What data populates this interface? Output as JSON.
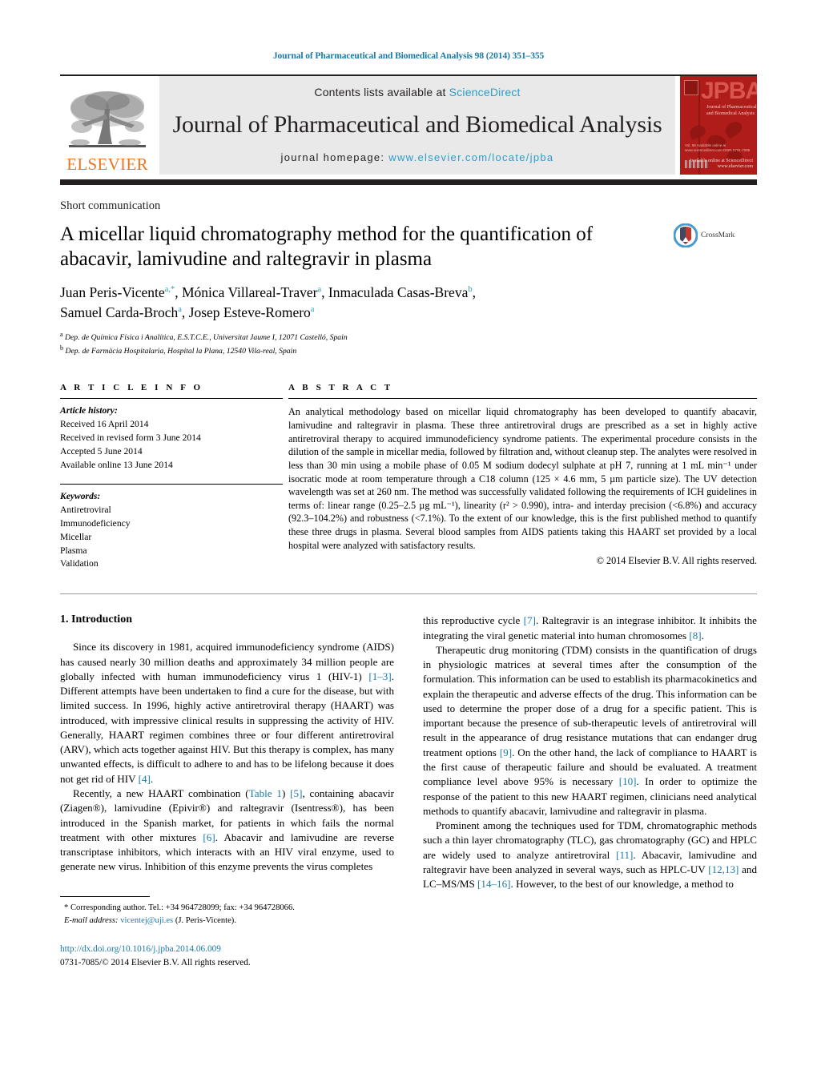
{
  "running_head": "Journal of Pharmaceutical and Biomedical Analysis 98 (2014) 351–355",
  "masthead": {
    "contents_prefix": "Contents lists available at ",
    "sciencedirect": "ScienceDirect",
    "journal_name": "Journal of Pharmaceutical and Biomedical Analysis",
    "homepage_prefix": "journal homepage: ",
    "homepage_url": "www.elsevier.com/locate/jpba",
    "publisher_wordmark": "ELSEVIER",
    "cover_acronym": "JPBA",
    "cover_subtitle": "Journal of Pharmaceutical and Biomedical Analysis",
    "cover_lowtext": "Vol. 98\nAvailable online at\nwww.sciencedirect.com\nISSN 0731-7085",
    "cover_footlogo": "Available online at\nScienceDirect\nwww.elsevier.com",
    "accent_blue": "#1a7aa8",
    "link_blue": "#2a9ecb",
    "elsevier_orange": "#e87722",
    "cover_red": "#b01c19",
    "bar_dark": "#231f20"
  },
  "article": {
    "type": "Short communication",
    "title": "A micellar liquid chromatography method for the quantification of abacavir, lamivudine and raltegravir in plasma",
    "crossmark_label": "CrossMark",
    "authors_line1_a": "Juan Peris-Vicente",
    "authors_line1_a_sup": "a,*",
    "authors_line1_b": ", Mónica Villareal-Traver",
    "authors_line1_b_sup": "a",
    "authors_line1_c": ", Inmaculada Casas-Breva",
    "authors_line1_c_sup": "b",
    "authors_line1_tail": ",",
    "authors_line2_a": "Samuel Carda-Broch",
    "authors_line2_a_sup": "a",
    "authors_line2_b": ", Josep Esteve-Romero",
    "authors_line2_b_sup": "a",
    "affiliation_a_sup": "a",
    "affiliation_a": "Dep. de Química Física i Analítica, E.S.T.C.E., Universitat Jaume I, 12071 Castelló, Spain",
    "affiliation_b_sup": "b",
    "affiliation_b": "Dep. de Farmàcia Hospitalaria, Hospital la Plana, 12540 Vila-real, Spain"
  },
  "article_info": {
    "heading": "A R T I C L E    I N F O",
    "history_title": "Article history:",
    "history": [
      "Received 16 April 2014",
      "Received in revised form 3 June 2014",
      "Accepted 5 June 2014",
      "Available online 13 June 2014"
    ],
    "keywords_title": "Keywords:",
    "keywords": [
      "Antiretroviral",
      "Immunodeficiency",
      "Micellar",
      "Plasma",
      "Validation"
    ]
  },
  "abstract": {
    "heading": "A B S T R A C T",
    "text": "An analytical methodology based on micellar liquid chromatography has been developed to quantify abacavir, lamivudine and raltegravir in plasma. These three antiretroviral drugs are prescribed as a set in highly active antiretroviral therapy to acquired immunodeficiency syndrome patients. The experimental procedure consists in the dilution of the sample in micellar media, followed by filtration and, without cleanup step. The analytes were resolved in less than 30 min using a mobile phase of 0.05 M sodium dodecyl sulphate at pH 7, running at 1 mL min⁻¹ under isocratic mode at room temperature through a C18 column (125 × 4.6 mm, 5 µm particle size). The UV detection wavelength was set at 260 nm. The method was successfully validated following the requirements of ICH guidelines in terms of: linear range (0.25–2.5 µg mL⁻¹), linearity (r² > 0.990), intra- and interday precision (<6.8%) and accuracy (92.3–104.2%) and robustness (<7.1%). To the extent of our knowledge, this is the first published method to quantify these three drugs in plasma. Several blood samples from AIDS patients taking this HAART set provided by a local hospital were analyzed with satisfactory results.",
    "copyright": "© 2014 Elsevier B.V. All rights reserved."
  },
  "body": {
    "section_heading": "1.  Introduction",
    "left_paragraphs": [
      {
        "parts": [
          {
            "t": "Since its discovery in 1981, acquired immunodeficiency syndrome (AIDS) has caused nearly 30 million deaths and approximately 34 million people are globally infected with human immunodeficiency virus 1 (HIV-1) "
          },
          {
            "t": "[1–3]",
            "link": true
          },
          {
            "t": ". Different attempts have been undertaken to find a cure for the disease, but with limited success. In 1996, highly active antiretroviral therapy (HAART) was introduced, with impressive clinical results in suppressing the activity of HIV. Generally, HAART regimen combines three or four different antiretroviral (ARV), which acts together against HIV. But this therapy is complex, has many unwanted effects, is difficult to adhere to and has to be lifelong because it does not get rid of HIV "
          },
          {
            "t": "[4]",
            "link": true
          },
          {
            "t": "."
          }
        ]
      },
      {
        "parts": [
          {
            "t": "Recently, a new HAART combination ("
          },
          {
            "t": "Table 1",
            "link": true
          },
          {
            "t": ") "
          },
          {
            "t": "[5]",
            "link": true
          },
          {
            "t": ", containing abacavir (Ziagen®), lamivudine (Epivir®) and raltegravir (Isentress®), has been introduced in the Spanish market, for patients in which fails the normal treatment with other mixtures "
          },
          {
            "t": "[6]",
            "link": true
          },
          {
            "t": ". Abacavir and lamivudine are reverse transcriptase inhibitors, which interacts with an HIV viral enzyme, used to generate new virus. Inhibition of this enzyme prevents the virus completes"
          }
        ]
      }
    ],
    "right_paragraphs": [
      {
        "continuation": true,
        "parts": [
          {
            "t": "this reproductive cycle "
          },
          {
            "t": "[7]",
            "link": true
          },
          {
            "t": ". Raltegravir is an integrase inhibitor. It inhibits the integrating the viral genetic material into human chromosomes "
          },
          {
            "t": "[8]",
            "link": true
          },
          {
            "t": "."
          }
        ]
      },
      {
        "parts": [
          {
            "t": "Therapeutic drug monitoring (TDM) consists in the quantification of drugs in physiologic matrices at several times after the consumption of the formulation. This information can be used to establish its pharmacokinetics and explain the therapeutic and adverse effects of the drug. This information can be used to determine the proper dose of a drug for a specific patient. This is important because the presence of sub-therapeutic levels of antiretroviral will result in the appearance of drug resistance mutations that can endanger drug treatment options "
          },
          {
            "t": "[9]",
            "link": true
          },
          {
            "t": ". On the other hand, the lack of compliance to HAART is the first cause of therapeutic failure and should be evaluated. A treatment compliance level above 95% is necessary "
          },
          {
            "t": "[10]",
            "link": true
          },
          {
            "t": ". In order to optimize the response of the patient to this new HAART regimen, clinicians need analytical methods to quantify abacavir, lamivudine and raltegravir in plasma."
          }
        ]
      },
      {
        "parts": [
          {
            "t": "Prominent among the techniques used for TDM, chromatographic methods such a thin layer chromatography (TLC), gas chromatography (GC) and HPLC are widely used to analyze antiretroviral "
          },
          {
            "t": "[11]",
            "link": true
          },
          {
            "t": ". Abacavir, lamivudine and raltegravir have been analyzed in several ways, such as HPLC-UV "
          },
          {
            "t": "[12,13]",
            "link": true
          },
          {
            "t": " and LC–MS/MS "
          },
          {
            "t": "[14–16]",
            "link": true
          },
          {
            "t": ". However, to the best of our knowledge, a method to"
          }
        ]
      }
    ]
  },
  "footer": {
    "corresponding_marker": "*",
    "corresponding_text": "Corresponding author. Tel.: +34 964728099; fax: +34 964728066.",
    "email_label": "E-mail address:",
    "email": "vicentej@uji.es",
    "email_owner": "(J. Peris-Vicente).",
    "doi": "http://dx.doi.org/10.1016/j.jpba.2014.06.009",
    "issn_line": "0731-7085/© 2014 Elsevier B.V. All rights reserved."
  }
}
